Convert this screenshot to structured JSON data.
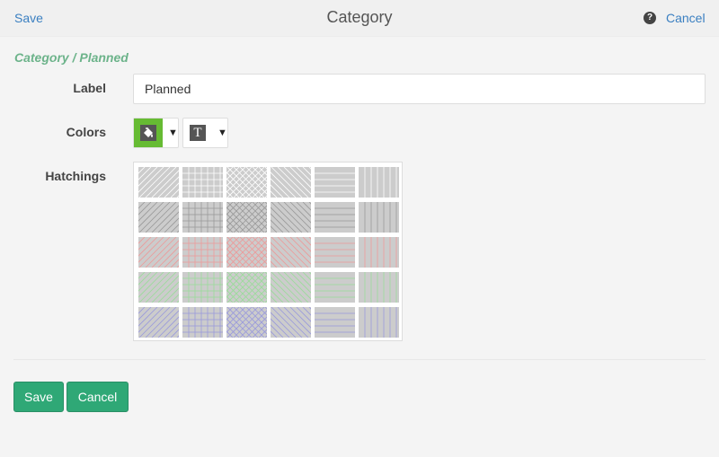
{
  "header": {
    "save_label": "Save",
    "title": "Category",
    "help_glyph": "?",
    "cancel_label": "Cancel"
  },
  "breadcrumb": "Category / Planned",
  "form": {
    "label_caption": "Label",
    "label_value": "Planned",
    "colors_caption": "Colors",
    "fill_color": "#66bb33",
    "fill_icon": "paint-bucket-icon",
    "text_color_glyph": "T",
    "text_icon": "text-color-icon",
    "dropdown_glyph": "▼",
    "hatchings_caption": "Hatchings"
  },
  "hatchings": {
    "patterns": [
      "diagonal-right",
      "grid",
      "diagonal-cross",
      "diagonal-left",
      "horizontal",
      "vertical"
    ],
    "line_colors": [
      "#ffffff",
      "#999999",
      "#ee9999",
      "#99dd99",
      "#9999dd"
    ],
    "background": "#cccccc"
  },
  "footer": {
    "save_label": "Save",
    "cancel_label": "Cancel"
  },
  "colors": {
    "link": "#3a7fc1",
    "accent": "#2fa876",
    "breadcrumb": "#6cb38a"
  }
}
